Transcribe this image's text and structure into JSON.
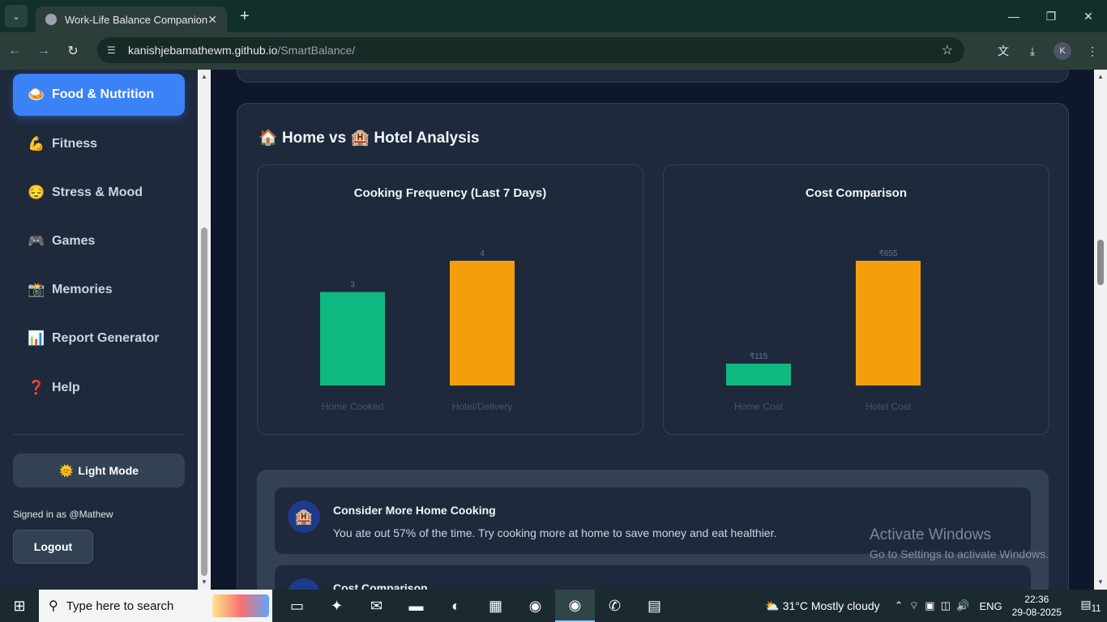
{
  "browser": {
    "tab_title": "Work-Life Balance Companion",
    "url_host": "kanishjebamathewm.github.io",
    "url_path": "/SmartBalance/",
    "profile_initial": "K"
  },
  "sidebar": {
    "items": [
      {
        "icon": "🍛",
        "label": "Food & Nutrition",
        "active": true
      },
      {
        "icon": "💪",
        "label": "Fitness"
      },
      {
        "icon": "😔",
        "label": "Stress & Mood"
      },
      {
        "icon": "🎮",
        "label": "Games"
      },
      {
        "icon": "📸",
        "label": "Memories"
      },
      {
        "icon": "📊",
        "label": "Report Generator"
      },
      {
        "icon": "❓",
        "label": "Help"
      }
    ],
    "theme_icon": "🌞",
    "theme_label": "Light Mode",
    "signed_in": "Signed in as @Mathew",
    "logout_label": "Logout"
  },
  "section": {
    "icon_home": "🏠",
    "title_a": "Home vs",
    "icon_hotel": "🏨",
    "title_b": "Hotel Analysis"
  },
  "chart_data": [
    {
      "type": "bar",
      "title": "Cooking Frequency (Last 7 Days)",
      "categories": [
        "Home Cooked",
        "Hotel/Delivery"
      ],
      "values": [
        3,
        4
      ],
      "value_labels": [
        "3",
        "4"
      ],
      "colors": [
        "#10b981",
        "#f59e0b"
      ],
      "ylim": [
        0,
        4
      ]
    },
    {
      "type": "bar",
      "title": "Cost Comparison",
      "categories": [
        "Home Cost",
        "Hotel Cost"
      ],
      "values": [
        115,
        655
      ],
      "value_labels": [
        "₹115",
        "₹655"
      ],
      "colors": [
        "#10b981",
        "#f59e0b"
      ],
      "ylim": [
        0,
        655
      ]
    }
  ],
  "insights": [
    {
      "icon": "🏨",
      "title": "Consider More Home Cooking",
      "text": "You ate out 57% of the time. Try cooking more at home to save money and eat healthier."
    },
    {
      "icon": "",
      "title": "Cost Comparison",
      "text": ""
    }
  ],
  "watermark": {
    "line1": "Activate Windows",
    "line2": "Go to Settings to activate Windows."
  },
  "taskbar": {
    "search_placeholder": "Type here to search",
    "weather": "31°C  Mostly cloudy",
    "lang": "ENG",
    "time": "22:36",
    "date": "29-08-2025",
    "notif_count": "11"
  }
}
